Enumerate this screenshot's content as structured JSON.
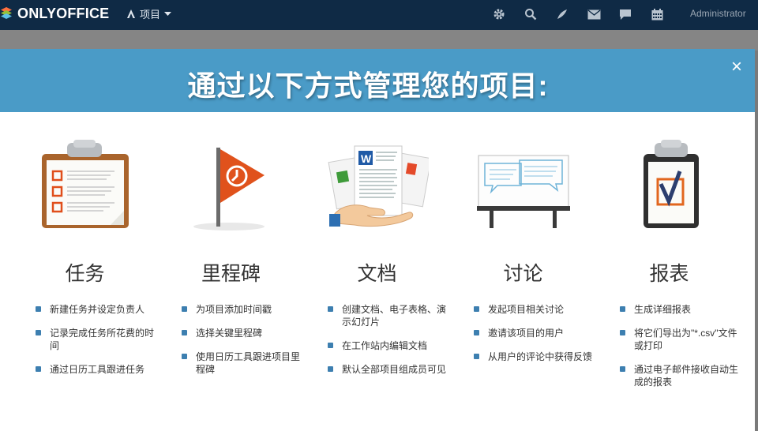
{
  "topbar": {
    "logo_text": "ONLYOFFICE",
    "project_menu_label": "项目",
    "icons": [
      "gear-icon",
      "search-icon",
      "feed-icon",
      "mail-icon",
      "chat-icon",
      "calendar-icon"
    ],
    "user_name": "Administrator"
  },
  "modal": {
    "title": "通过以下方式管理您的项目:",
    "close_label": "×",
    "accent_color": "#4a9bc7",
    "columns": [
      {
        "title": "任务",
        "icon": "clipboard-checklist-icon",
        "items": [
          "新建任务并设定负责人",
          "记录完成任务所花费的时间",
          "通过日历工具跟进任务"
        ]
      },
      {
        "title": "里程碑",
        "icon": "milestone-flag-icon",
        "items": [
          "为项目添加时间戳",
          "选择关键里程碑",
          "使用日历工具跟进项目里程碑"
        ]
      },
      {
        "title": "文档",
        "icon": "documents-icon",
        "items": [
          "创建文档、电子表格、演示幻灯片",
          "在工作站内编辑文档",
          "默认全部项目组成员可见"
        ]
      },
      {
        "title": "讨论",
        "icon": "discussion-board-icon",
        "items": [
          "发起项目相关讨论",
          "邀请该项目的用户",
          "从用户的评论中获得反馈"
        ]
      },
      {
        "title": "报表",
        "icon": "report-clipboard-icon",
        "items": [
          "生成详细报表",
          "将它们导出为\"*.csv\"文件或打印",
          "通过电子邮件接收自动生成的报表"
        ]
      }
    ]
  }
}
